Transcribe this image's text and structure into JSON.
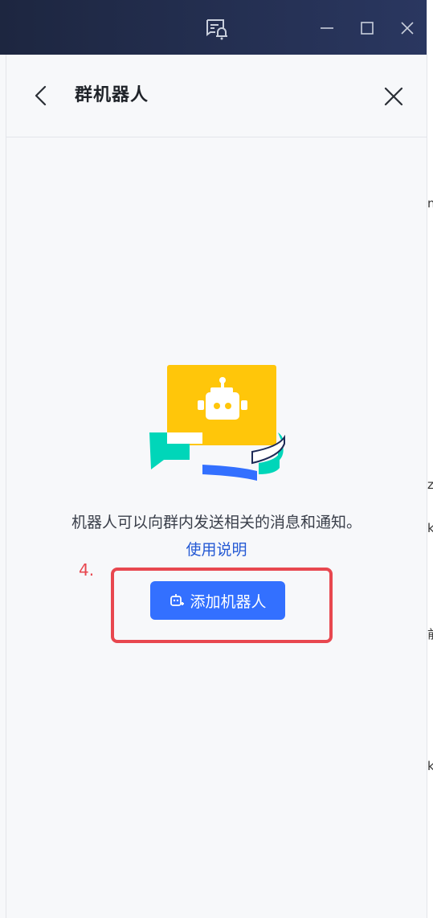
{
  "window": {
    "controls": [
      "minimize-icon",
      "maximize-icon",
      "close-icon"
    ],
    "top_icon": "chat-alert-icon"
  },
  "header": {
    "title": "群机器人",
    "back_icon": "chevron-left-icon",
    "close_icon": "close-icon"
  },
  "empty_state": {
    "illustration": "robot-chat-illustration",
    "description": "机器人可以向群内发送相关的消息和通知。",
    "help_link": "使用说明",
    "add_button": "添加机器人",
    "add_button_icon": "add-robot-icon"
  },
  "annotation": {
    "step_label": "4."
  },
  "edge_clipped_text": [
    "n",
    "z",
    "k",
    "前",
    "k"
  ],
  "colors": {
    "accent": "#3370ff",
    "link": "#2459d4",
    "annotation": "#e8474f",
    "titlebar": "#1d2640",
    "illustration_yellow": "#ffc60a",
    "illustration_teal": "#00d6b9",
    "illustration_blue": "#3370ff",
    "illustration_navy": "#1d2a57"
  }
}
